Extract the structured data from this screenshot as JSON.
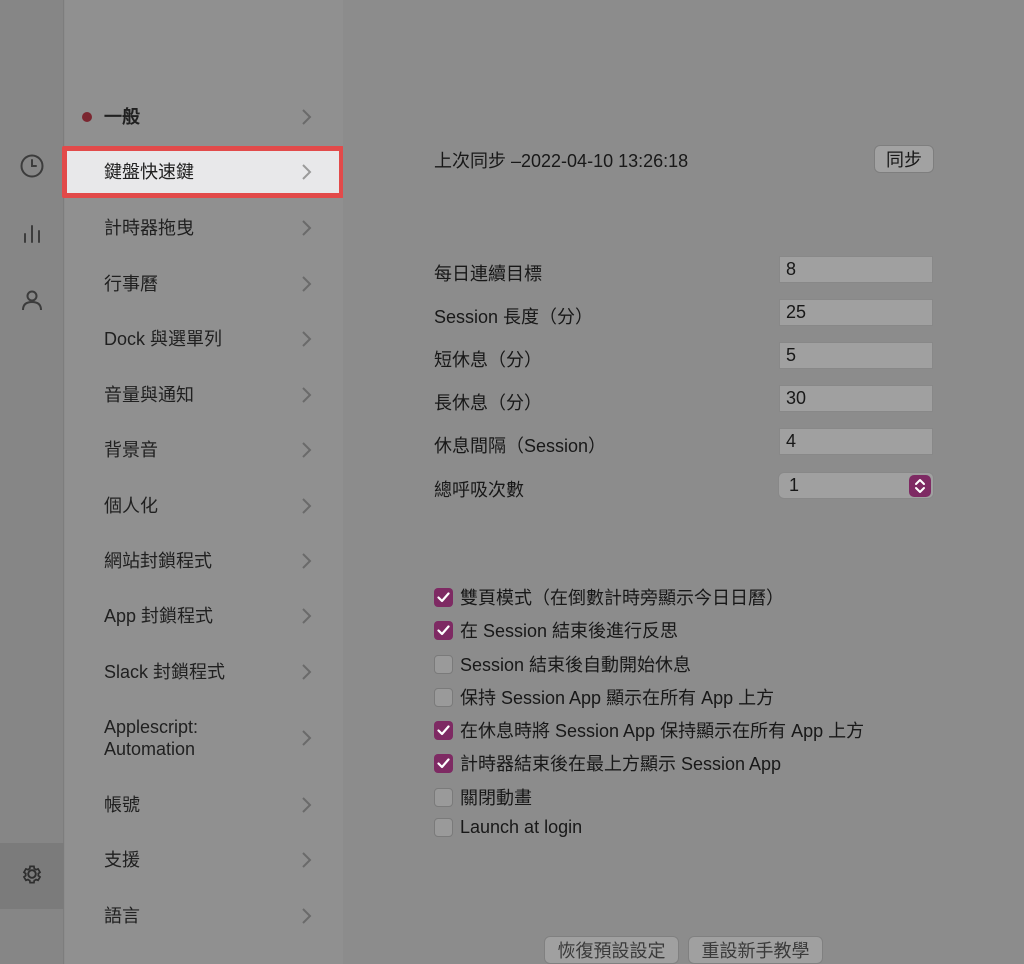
{
  "window": {
    "traffic_lights": [
      "close",
      "minimize",
      "maximize"
    ]
  },
  "rail": {
    "icons": [
      "clock-icon",
      "bar-chart-icon",
      "person-icon",
      "gear-icon"
    ]
  },
  "sidebar": {
    "items": [
      {
        "label": "一般"
      },
      {
        "label": "鍵盤快速鍵"
      },
      {
        "label": "計時器拖曳"
      },
      {
        "label": "行事曆"
      },
      {
        "label": "Dock 與選單列"
      },
      {
        "label": "音量與通知"
      },
      {
        "label": "背景音"
      },
      {
        "label": "個人化"
      },
      {
        "label": "網站封鎖程式"
      },
      {
        "label": "App 封鎖程式"
      },
      {
        "label": "Slack 封鎖程式"
      },
      {
        "label": "Applescript:\nAutomation"
      },
      {
        "label": "帳號"
      },
      {
        "label": "支援"
      },
      {
        "label": "語言"
      }
    ]
  },
  "main": {
    "sync_text": "上次同步 –2022-04-10 13:26:18",
    "sync_button": "同步",
    "fields": [
      {
        "label": "每日連續目標",
        "value": "8"
      },
      {
        "label": "Session 長度（分）",
        "value": "25"
      },
      {
        "label": "短休息（分）",
        "value": "5"
      },
      {
        "label": "長休息（分）",
        "value": "30"
      },
      {
        "label": "休息間隔（Session）",
        "value": "4"
      }
    ],
    "breath": {
      "label": "總呼吸次數",
      "value": "1"
    },
    "checkboxes": [
      {
        "label": "雙頁模式（在倒數計時旁顯示今日日曆）",
        "checked": true
      },
      {
        "label": "在 Session 結束後進行反思",
        "checked": true
      },
      {
        "label": "Session 結束後自動開始休息",
        "checked": false
      },
      {
        "label": "保持 Session App 顯示在所有 App  上方",
        "checked": false
      },
      {
        "label": "在休息時將 Session App 保持顯示在所有 App  上方",
        "checked": true
      },
      {
        "label": "計時器結束後在最上方顯示 Session App",
        "checked": true
      },
      {
        "label": "關閉動畫",
        "checked": false
      },
      {
        "label": "Launch at login",
        "checked": false
      }
    ],
    "restore_button": "恢復預設設定",
    "reset_tutorial_button": "重設新手教學"
  },
  "colors": {
    "accent": "#7e2a63",
    "highlight_red": "#e24a4a"
  }
}
